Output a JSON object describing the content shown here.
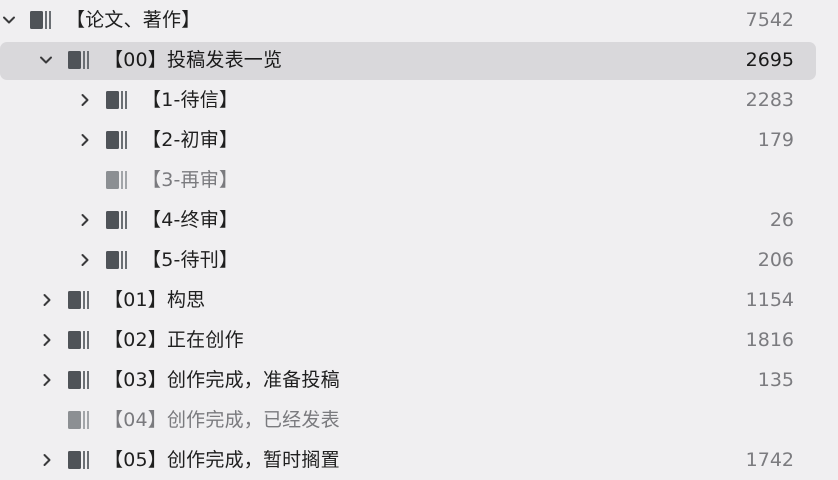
{
  "tree": {
    "rows": [
      {
        "label": "【论文、著作】",
        "count": "7542",
        "expanded": true,
        "has_children": true,
        "selected": false,
        "dim": false
      },
      {
        "label": "【00】投稿发表一览",
        "count": "2695",
        "expanded": true,
        "has_children": true,
        "selected": true,
        "dim": false
      },
      {
        "label": "【1-待信】",
        "count": "2283",
        "expanded": false,
        "has_children": true,
        "selected": false,
        "dim": false
      },
      {
        "label": "【2-初审】",
        "count": "179",
        "expanded": false,
        "has_children": true,
        "selected": false,
        "dim": false
      },
      {
        "label": "【3-再审】",
        "count": "",
        "expanded": false,
        "has_children": false,
        "selected": false,
        "dim": true
      },
      {
        "label": "【4-终审】",
        "count": "26",
        "expanded": false,
        "has_children": true,
        "selected": false,
        "dim": false
      },
      {
        "label": "【5-待刊】",
        "count": "206",
        "expanded": false,
        "has_children": true,
        "selected": false,
        "dim": false
      },
      {
        "label": "【01】构思",
        "count": "1154",
        "expanded": false,
        "has_children": true,
        "selected": false,
        "dim": false
      },
      {
        "label": "【02】正在创作",
        "count": "1816",
        "expanded": false,
        "has_children": true,
        "selected": false,
        "dim": false
      },
      {
        "label": "【03】创作完成，准备投稿",
        "count": "135",
        "expanded": false,
        "has_children": true,
        "selected": false,
        "dim": false
      },
      {
        "label": "【04】创作完成，已经发表",
        "count": "",
        "expanded": false,
        "has_children": false,
        "selected": false,
        "dim": true
      },
      {
        "label": "【05】创作完成，暂时搁置",
        "count": "1742",
        "expanded": false,
        "has_children": true,
        "selected": false,
        "dim": false
      }
    ]
  },
  "icons": {
    "chevron_expanded": "chevron-down-icon",
    "chevron_collapsed": "chevron-right-icon",
    "notebook": "notebook-stack-icon"
  },
  "colors": {
    "background": "#f0eff1",
    "selection": "#d9d8db",
    "count_text": "#7b7b7f",
    "dim_text": "#7a7a7e"
  }
}
